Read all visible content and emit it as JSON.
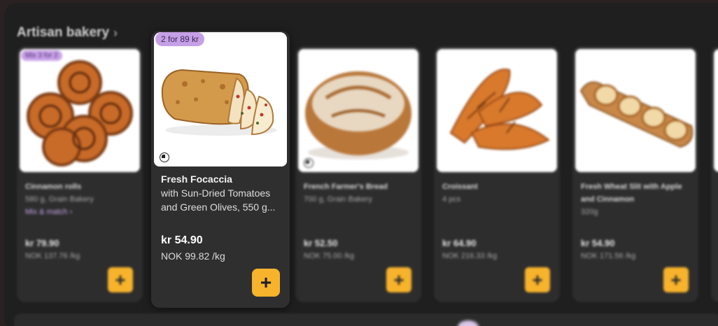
{
  "section": {
    "title": "Artisan bakery",
    "chevron": "›"
  },
  "focused_product": {
    "badge": "2 for 89 kr",
    "name": "Fresh Focaccia",
    "description": "with Sun-Dried Tomatoes and Green Olives, 550 g...",
    "price": "kr 54.90",
    "unit_price": "NOK 99.82 /kg",
    "add_label": "+"
  },
  "products": [
    {
      "badge": "Mix 3 for 2",
      "name": "Cinnamon rolls",
      "detail": "580 g, Grain Bakery",
      "mix": "Mix & match  ›",
      "price": "kr 79.90",
      "unit_price": "NOK 137.76 /kg",
      "add_label": "+"
    },
    {
      "name": "French Farmer's Bread",
      "detail": "700 g, Grain Bakery",
      "price": "kr 52.50",
      "unit_price": "NOK 75.00 /kg",
      "add_label": "+"
    },
    {
      "name": "Croissant",
      "detail": "4 pcs",
      "price": "kr 64.90",
      "unit_price": "NOK 216.33 /kg",
      "add_label": "+"
    },
    {
      "name": "Fresh Wheat Slit with Apple and Cinnamon",
      "detail": "320g",
      "price": "kr 54.90",
      "unit_price": "NOK 171.56 /kg",
      "add_label": "+"
    }
  ],
  "colors": {
    "accent": "#f7b32b",
    "badge": "#c8a2e8",
    "card": "#2d2d2d",
    "background": "#1f1f1f"
  }
}
